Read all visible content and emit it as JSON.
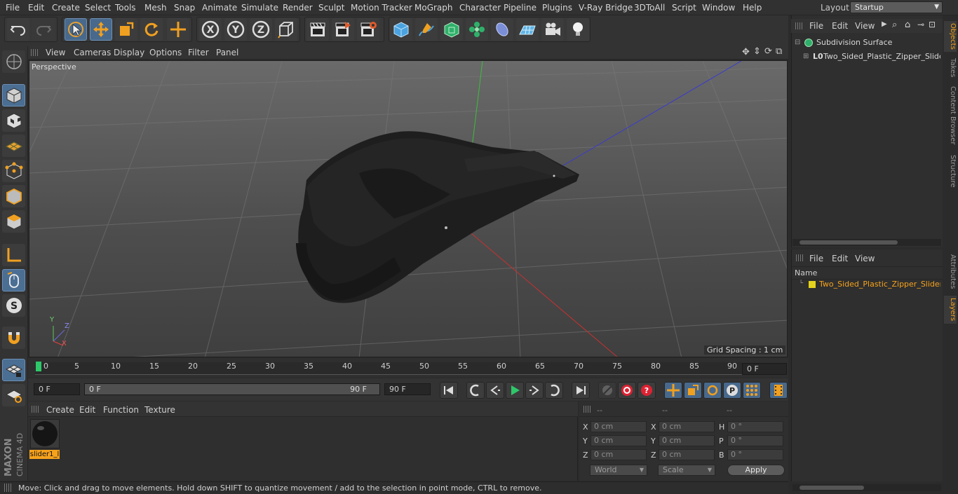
{
  "menubar": {
    "items": [
      "File",
      "Edit",
      "Create",
      "Select",
      "Tools",
      "Mesh",
      "Snap",
      "Animate",
      "Simulate",
      "Render",
      "Sculpt",
      "Motion Tracker",
      "MoGraph",
      "Character",
      "Pipeline",
      "Plugins",
      "V-Ray Bridge",
      "3DToAll",
      "Script",
      "Window",
      "Help"
    ],
    "layout_label": "Layout:",
    "layout_value": "Startup"
  },
  "viewport": {
    "menu": [
      "View",
      "Cameras",
      "Display",
      "Options",
      "Filter",
      "Panel"
    ],
    "label": "Perspective",
    "grid_spacing": "Grid Spacing : 1 cm",
    "axis_y": "Y",
    "axis_z": "Z",
    "axis_x": "X"
  },
  "timeline": {
    "ticks": [
      "0",
      "5",
      "10",
      "15",
      "20",
      "25",
      "30",
      "35",
      "40",
      "45",
      "50",
      "55",
      "60",
      "65",
      "70",
      "75",
      "80",
      "85",
      "90"
    ],
    "current_frame": "0 F",
    "start_field": "0 F",
    "range_start": "0 F",
    "range_end": "90 F",
    "end_field": "90 F"
  },
  "material_manager": {
    "menu": [
      "Create",
      "Edit",
      "Function",
      "Texture"
    ],
    "material_name": "slider1_l"
  },
  "coordinates": {
    "headers": [
      "--",
      "--",
      "--"
    ],
    "rows": [
      {
        "l1": "X",
        "v1": "0 cm",
        "l2": "X",
        "v2": "0 cm",
        "l3": "H",
        "v3": "0 °"
      },
      {
        "l1": "Y",
        "v1": "0 cm",
        "l2": "Y",
        "v2": "0 cm",
        "l3": "P",
        "v3": "0 °"
      },
      {
        "l1": "Z",
        "v1": "0 cm",
        "l2": "Z",
        "v2": "0 cm",
        "l3": "B",
        "v3": "0 °"
      }
    ],
    "space": "World",
    "mode": "Scale",
    "apply": "Apply"
  },
  "objects_panel": {
    "menu": [
      "File",
      "Edit",
      "View"
    ],
    "items": [
      "Subdivision Surface",
      "Two_Sided_Plastic_Zipper_Slider_"
    ]
  },
  "layers_panel": {
    "menu": [
      "File",
      "Edit",
      "View"
    ],
    "column": "Name",
    "items": [
      "Two_Sided_Plastic_Zipper_Slider_l"
    ]
  },
  "side_tabs_top": [
    "Objects",
    "Takes",
    "Content Browser",
    "Structure"
  ],
  "side_tabs_bottom": [
    "Attributes",
    "Layers"
  ],
  "status": "Move: Click and drag to move elements. Hold down SHIFT to quantize movement / add to the selection in point mode, CTRL to remove.",
  "logo": {
    "brand": "MAXON",
    "product": "CINEMA 4D"
  },
  "colors": {
    "accent": "#f6a21c",
    "selection_blue": "#48698c",
    "layer_yellow": "#e5d21c"
  }
}
